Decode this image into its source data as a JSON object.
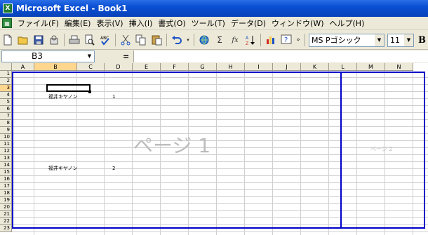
{
  "window": {
    "title": "Microsoft Excel - Book1",
    "app_icon": "X"
  },
  "menu": {
    "items": [
      "ファイル(F)",
      "編集(E)",
      "表示(V)",
      "挿入(I)",
      "書式(O)",
      "ツール(T)",
      "データ(D)",
      "ウィンドウ(W)",
      "ヘルプ(H)"
    ]
  },
  "toolbar": {
    "font_name": "MS Pゴシック",
    "font_size": "11",
    "bold_label": "B",
    "sigma": "Σ",
    "fx": "fx"
  },
  "formula_bar": {
    "name_box": "B3",
    "equals": "="
  },
  "sheet": {
    "columns": [
      "A",
      "B",
      "C",
      "D",
      "E",
      "F",
      "G",
      "H",
      "I",
      "J",
      "K",
      "L",
      "M",
      "N"
    ],
    "rows": [
      "1",
      "2",
      "3",
      "4",
      "5",
      "6",
      "7",
      "8",
      "9",
      "10",
      "11",
      "12",
      "13",
      "14",
      "15",
      "16",
      "17",
      "18",
      "19",
      "20",
      "21",
      "22",
      "23"
    ],
    "selected_column": "B",
    "selected_row": "3",
    "cells": {
      "b4": "福井キヤノン",
      "c4": "1",
      "b14": "福井キヤノン",
      "c14": "2"
    },
    "page_labels": {
      "page1": "ページ 1",
      "page2": "ページ 2"
    }
  },
  "colors": {
    "title_bar": "#0a4fd4",
    "page_border": "#0000c8",
    "selected_header": "#ffd68e"
  }
}
